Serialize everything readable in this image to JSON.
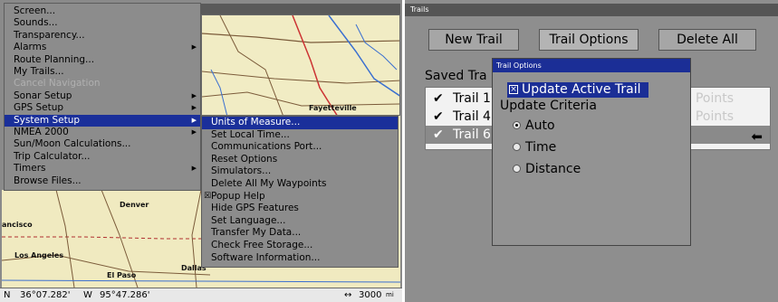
{
  "left": {
    "main_menu": [
      {
        "label": "Screen...",
        "state": "normal",
        "submenu": false
      },
      {
        "label": "Sounds...",
        "state": "normal",
        "submenu": false
      },
      {
        "label": "Transparency...",
        "state": "normal",
        "submenu": false
      },
      {
        "label": "Alarms",
        "state": "normal",
        "submenu": true
      },
      {
        "label": "Route Planning...",
        "state": "normal",
        "submenu": false
      },
      {
        "label": "My Trails...",
        "state": "normal",
        "submenu": false
      },
      {
        "label": "Cancel Navigation",
        "state": "disabled",
        "submenu": false
      },
      {
        "label": "Sonar Setup",
        "state": "normal",
        "submenu": true
      },
      {
        "label": "GPS Setup",
        "state": "normal",
        "submenu": true
      },
      {
        "label": "System Setup",
        "state": "selected",
        "submenu": true
      },
      {
        "label": "NMEA 2000",
        "state": "normal",
        "submenu": true
      },
      {
        "label": "Sun/Moon Calculations...",
        "state": "normal",
        "submenu": false
      },
      {
        "label": "Trip Calculator...",
        "state": "normal",
        "submenu": false
      },
      {
        "label": "Timers",
        "state": "normal",
        "submenu": true
      },
      {
        "label": "Browse Files...",
        "state": "normal",
        "submenu": false
      }
    ],
    "sub_menu": [
      {
        "label": "Units of Measure...",
        "state": "selected",
        "checked": false
      },
      {
        "label": "Set Local Time...",
        "state": "normal",
        "checked": false
      },
      {
        "label": "Communications Port...",
        "state": "normal",
        "checked": false
      },
      {
        "label": "Reset Options",
        "state": "normal",
        "checked": false
      },
      {
        "label": "Simulators...",
        "state": "normal",
        "checked": false
      },
      {
        "label": "Delete All My Waypoints",
        "state": "normal",
        "checked": false
      },
      {
        "label": "Popup Help",
        "state": "normal",
        "checked": true
      },
      {
        "label": "Hide GPS Features",
        "state": "normal",
        "checked": false
      },
      {
        "label": "Set Language...",
        "state": "normal",
        "checked": false
      },
      {
        "label": "Transfer My Data...",
        "state": "normal",
        "checked": false
      },
      {
        "label": "Check Free Storage...",
        "state": "normal",
        "checked": false
      },
      {
        "label": "Software Information...",
        "state": "normal",
        "checked": false
      }
    ],
    "map_labels": {
      "fayetteville": "Fayetteville",
      "denver": "Denver",
      "francisco": "ancisco",
      "los_angeles": "Los Angeles",
      "el_paso": "El Paso",
      "dallas": "Dallas"
    },
    "status": {
      "lat_prefix": "N",
      "lat": "36°07.282'",
      "lon_prefix": "W",
      "lon": "95°47.286'",
      "zoom": "3000",
      "zoom_unit": "mi"
    }
  },
  "right": {
    "title": "Trails",
    "buttons": {
      "new_trail": "New Trail",
      "trail_options": "Trail Options",
      "delete_all": "Delete All"
    },
    "saved_label": "Saved Tra",
    "trails": [
      {
        "name": "Trail 1",
        "right_text": "Points",
        "selected": false
      },
      {
        "name": "Trail 4",
        "right_text": "6 Points",
        "selected": false
      },
      {
        "name": "Trail 6",
        "right_text": "",
        "selected": true
      }
    ],
    "dialog": {
      "title": "Trail Options",
      "update_active_trail": "Update Active Trail",
      "update_active_checked": true,
      "criteria_label": "Update Criteria",
      "options": [
        {
          "label": "Auto",
          "selected": true
        },
        {
          "label": "Time",
          "selected": false
        },
        {
          "label": "Distance",
          "selected": false
        }
      ]
    }
  },
  "colors": {
    "highlight": "#1a2f9a",
    "menu_bg": "#8c8c8c",
    "map_bg": "#f1ecc4"
  }
}
